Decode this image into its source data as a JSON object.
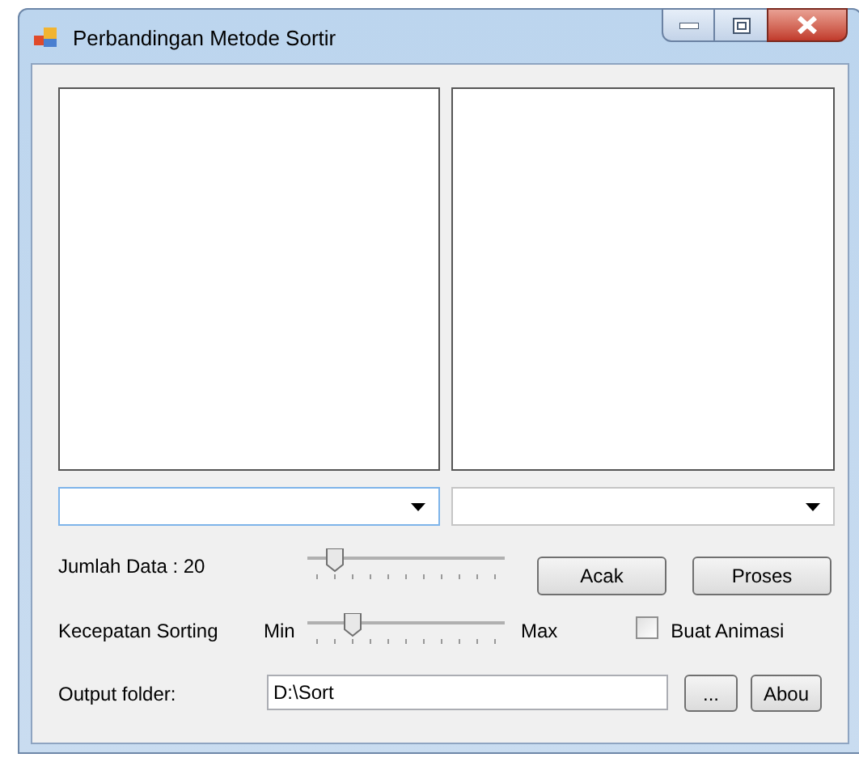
{
  "window": {
    "title": "Perbandingan Metode Sortir"
  },
  "combos": [
    {
      "focused": true
    },
    {
      "focused": false
    }
  ],
  "jumlah": {
    "label": "Jumlah Data : 20",
    "level": 0.1
  },
  "buttons": [
    "Acak",
    "Proses"
  ],
  "kecepatan": {
    "label": "Kecepatan Sorting",
    "min": "Min",
    "max": "Max",
    "level": 0.2
  },
  "animasi": {
    "label": "Buat Animasi",
    "checked": false
  },
  "output": {
    "label": "Output folder:",
    "value": "D:\\Sort",
    "browse": "...",
    "about": "Abou"
  }
}
